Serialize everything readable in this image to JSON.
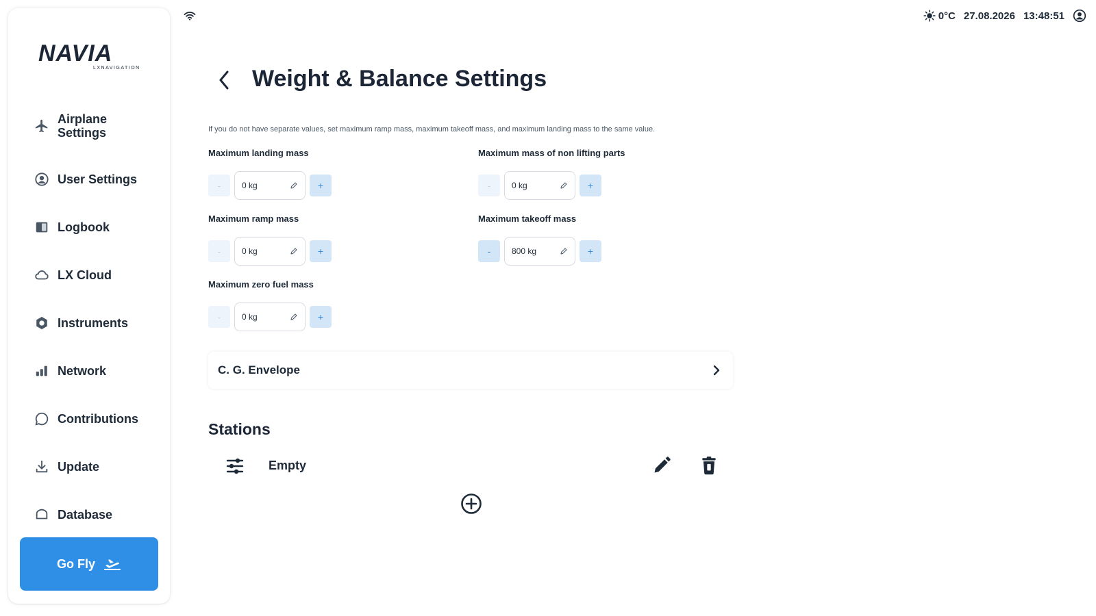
{
  "brand": {
    "logo_text": "NAVIA",
    "logo_subtext": "LXNAVIGATION"
  },
  "status_bar": {
    "wifi_icon": "wifi-icon",
    "weather_icon": "sun-icon",
    "temperature": "0°C",
    "date": "27.08.2026",
    "time": "13:48:51",
    "account_icon": "user-circle-icon"
  },
  "sidebar": {
    "items": [
      {
        "label": "Airplane\nSettings",
        "icon": "airplane-icon"
      },
      {
        "label": "User Settings",
        "icon": "user-icon"
      },
      {
        "label": "Logbook",
        "icon": "book-icon"
      },
      {
        "label": "LX Cloud",
        "icon": "cloud-icon"
      },
      {
        "label": "Instruments",
        "icon": "hexagon-icon"
      },
      {
        "label": "Network",
        "icon": "bars-icon"
      },
      {
        "label": "Contributions",
        "icon": "chat-icon"
      },
      {
        "label": "Update",
        "icon": "download-icon"
      },
      {
        "label": "Database",
        "icon": "database-icon"
      }
    ],
    "go_fly_label": "Go Fly"
  },
  "page": {
    "title": "Weight & Balance Settings",
    "note": "If you do not have separate values, set maximum ramp mass, maximum takeoff mass, and maximum landing mass to the same value."
  },
  "fields": {
    "max_landing": {
      "label": "Maximum landing mass",
      "value": "0 kg"
    },
    "max_non_lifting": {
      "label": "Maximum mass of non lifting parts",
      "value": "0 kg"
    },
    "max_ramp": {
      "label": "Maximum ramp mass",
      "value": "0 kg"
    },
    "max_takeoff": {
      "label": "Maximum takeoff mass",
      "value": "800 kg"
    },
    "max_zero_fuel": {
      "label": "Maximum zero fuel mass",
      "value": "0 kg"
    }
  },
  "stepper": {
    "minus": "-",
    "plus": "+"
  },
  "envelope": {
    "label": "C. G. Envelope"
  },
  "stations": {
    "title": "Stations",
    "items": [
      {
        "label": "Empty"
      }
    ]
  },
  "colors": {
    "accent": "#2f8fe6",
    "text": "#1e2a38",
    "stepper_bg": "#d3e6f8"
  }
}
